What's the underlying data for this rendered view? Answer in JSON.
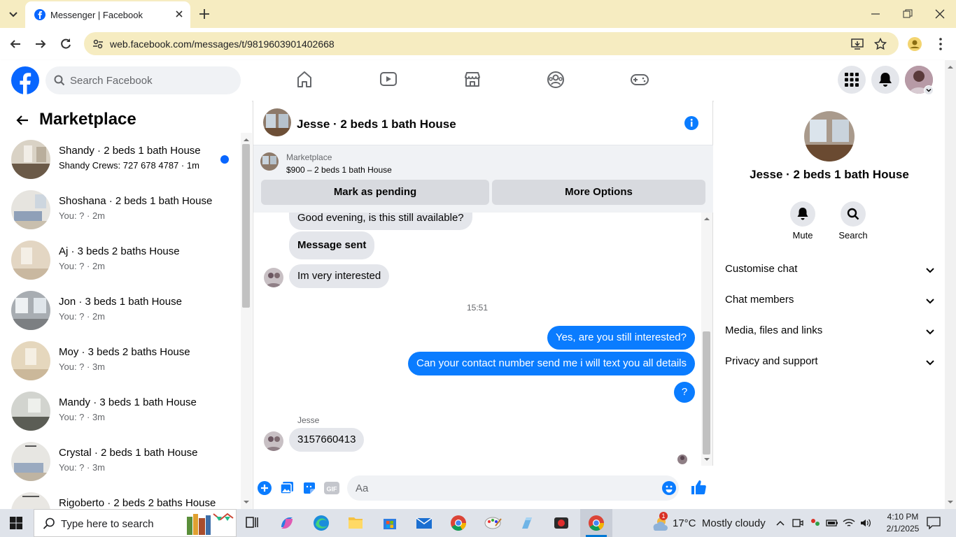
{
  "browser": {
    "tab_title": "Messenger | Facebook",
    "url": "web.facebook.com/messages/t/9819603901402668"
  },
  "fb": {
    "search_placeholder": "Search Facebook"
  },
  "left": {
    "title": "Marketplace",
    "conversations": [
      {
        "name": "Shandy · 2 beds 1 bath House",
        "sub": "Shandy Crews: 727 678 4787 · 1m",
        "unread": true
      },
      {
        "name": "Shoshana · 2 beds 1 bath House",
        "sub": "You: ? · 2m"
      },
      {
        "name": "Aj · 3 beds 2 baths House",
        "sub": "You: ? · 2m"
      },
      {
        "name": "Jon · 3 beds 1 bath House",
        "sub": "You: ? · 2m"
      },
      {
        "name": "Moy · 3 beds 2 baths House",
        "sub": "You: ? · 3m"
      },
      {
        "name": "Mandy · 3 beds 1 bath House",
        "sub": "You: ? · 3m"
      },
      {
        "name": "Crystal · 2 beds 1 bath House",
        "sub": "You: ? · 3m"
      },
      {
        "name": "Rigoberto · 2 beds 2 baths House",
        "sub": ""
      }
    ]
  },
  "chat": {
    "title": "Jesse · 2 beds 1 bath House",
    "listing_source": "Marketplace",
    "listing_price": "$900 – 2 beds 1 bath House",
    "mark_pending": "Mark as pending",
    "more_options": "More Options",
    "messages": {
      "m1": "Good evening, is this still available?",
      "m2": "Message sent",
      "m3": "Im very interested",
      "timestamp": "15:51",
      "m4": "Yes, are you still interested?",
      "m5": "Can your contact number send me i will text you all details",
      "m6": "?",
      "sender": "Jesse",
      "m7": "3157660413"
    },
    "composer_placeholder": "Aa"
  },
  "info": {
    "name": "Jesse · 2 beds 1 bath House",
    "mute": "Mute",
    "search": "Search",
    "sections": [
      "Customise chat",
      "Chat members",
      "Media, files and links",
      "Privacy and support"
    ]
  },
  "taskbar": {
    "search_placeholder": "Type here to search",
    "weather": "17°C  Mostly cloudy",
    "time": "4:10 PM",
    "date": "2/1/2025",
    "mail_badge": "1"
  },
  "colors": {
    "messenger_blue": "#0a7cff",
    "fb_blue": "#0866ff",
    "chrome_yellow": "#f6ecc1"
  }
}
